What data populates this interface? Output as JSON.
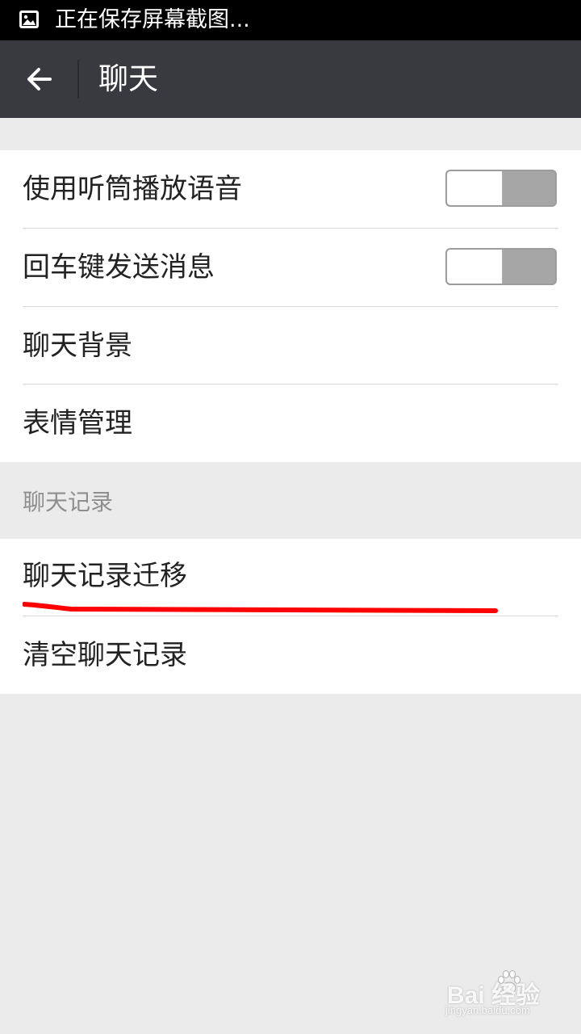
{
  "status_bar": {
    "text": "正在保存屏幕截图...",
    "icon": "image-icon"
  },
  "action_bar": {
    "back_icon": "arrow-left-icon",
    "title": "聊天"
  },
  "settings_group_1": {
    "items": [
      {
        "label": "使用听筒播放语音",
        "type": "toggle",
        "enabled": false
      },
      {
        "label": "回车键发送消息",
        "type": "toggle",
        "enabled": false
      },
      {
        "label": "聊天背景",
        "type": "link"
      },
      {
        "label": "表情管理",
        "type": "link"
      }
    ]
  },
  "section_chat_history": {
    "header": "聊天记录",
    "items": [
      {
        "label": "聊天记录迁移",
        "type": "link",
        "annotated": true
      },
      {
        "label": "清空聊天记录",
        "type": "link"
      }
    ]
  },
  "watermark": {
    "logo": "Bai  经验",
    "sub": "jingyan.baidu.com"
  },
  "colors": {
    "status_bar": "#000000",
    "action_bar": "#393a3f",
    "background": "#ebebeb",
    "row_background": "#ffffff",
    "annotation": "#ff0000",
    "toggle_off": "#a5a6a5"
  }
}
